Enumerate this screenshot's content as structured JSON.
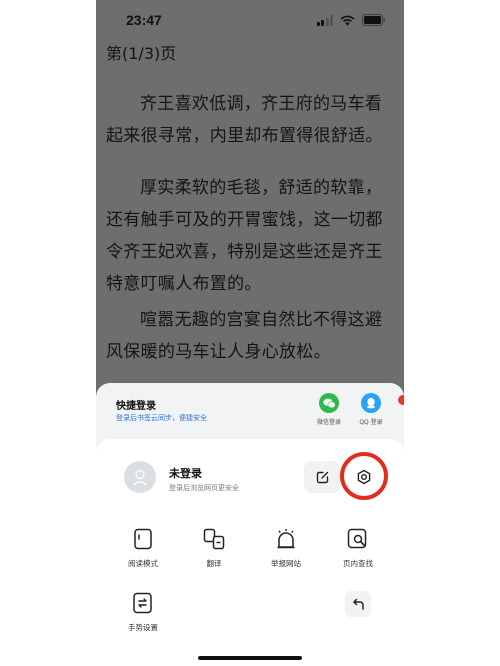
{
  "status_bar": {
    "time": "23:47"
  },
  "reader": {
    "page_indicator": "第(1/3)页",
    "paragraphs": [
      "齐王喜欢低调，齐王府的马车看起来很寻常，内里却布置得很舒适。",
      "厚实柔软的毛毯，舒适的软靠，还有触手可及的开胃蜜饯，这一切都令齐王妃欢喜，特别是这些还是齐王特意叮嘱人布置的。",
      "喧嚣无趣的宫宴自然比不得这避风保暖的马车让人身心放松。"
    ]
  },
  "quick_login": {
    "title": "快捷登录",
    "subtitle": "登录后书签云同步，便捷安全",
    "wechat_label": "微信登录",
    "qq_label": "QQ 登录"
  },
  "user": {
    "name": "未登录",
    "subtitle": "登录后浏览网页更安全"
  },
  "menu": {
    "reading_mode": "阅读模式",
    "translate": "翻译",
    "report_site": "举报网站",
    "find_in_page": "页内查找",
    "gesture_settings": "手势设置"
  },
  "colors": {
    "highlight": "#e02d20",
    "wechat": "#2cba4a",
    "qq": "#2aa3f5",
    "link": "#2f6fd8"
  }
}
